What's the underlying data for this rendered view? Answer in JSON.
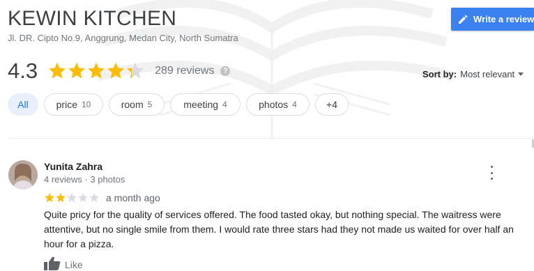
{
  "business": {
    "name": "KEWIN KITCHEN",
    "address": "Jl. DR. Cipto No.9, Anggrung, Medan City, North Sumatra"
  },
  "write_review": {
    "label": "Write a review",
    "icon": "pencil-icon",
    "color": "#3b82f0"
  },
  "rating": {
    "value": "4.3",
    "stars_value": 4.3,
    "reviews_label": "289 reviews",
    "help_icon": "?"
  },
  "sort": {
    "label": "Sort by:",
    "value": "Most relevant"
  },
  "filters": [
    {
      "label": "All",
      "count": "",
      "active": true
    },
    {
      "label": "price",
      "count": "10",
      "active": false
    },
    {
      "label": "room",
      "count": "5",
      "active": false
    },
    {
      "label": "meeting",
      "count": "4",
      "active": false
    },
    {
      "label": "photos",
      "count": "4",
      "active": false
    },
    {
      "label": "+4",
      "count": "",
      "active": false
    }
  ],
  "review": {
    "author": "Yunita Zahra",
    "meta": "4 reviews · 3 photos",
    "stars_value": 2,
    "date": "a month ago",
    "text": "Quite pricy for the quality of services offered. The food tasted okay, but nothing special. The waitress were attentive, but no single smile from them. I would rate three stars had they not made us waited for over half an hour for a pizza.",
    "like_label": "Like"
  },
  "colors": {
    "star_filled": "#fbbc04",
    "star_empty": "#dadce0",
    "chip_active_bg": "#e8f0fe",
    "chip_active_text": "#1a73e8"
  }
}
